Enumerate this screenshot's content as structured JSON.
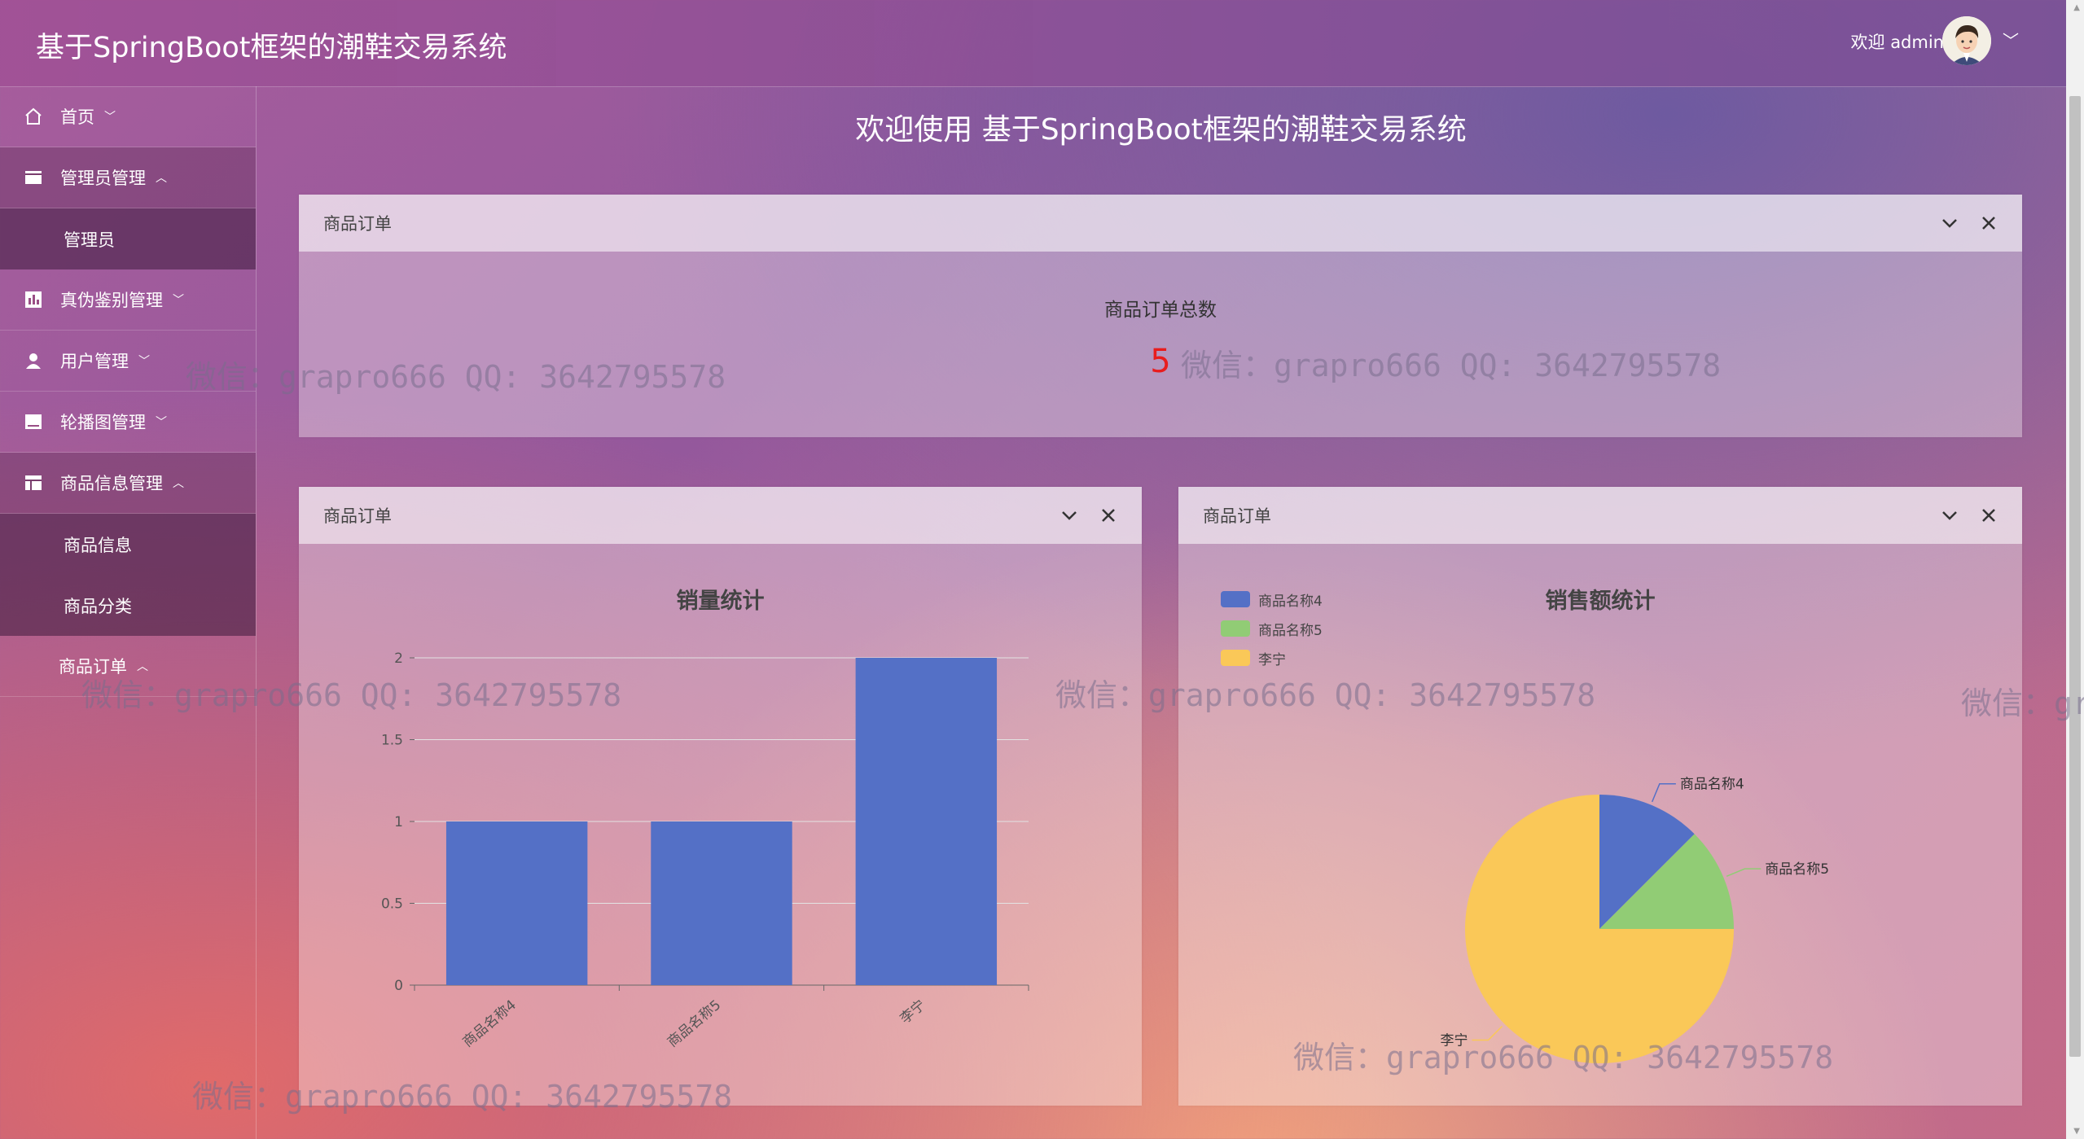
{
  "header": {
    "title": "基于SpringBoot框架的潮鞋交易系统",
    "welcome": "欢迎 admin"
  },
  "sidebar": {
    "items": [
      {
        "label": "首页",
        "icon": "home-icon",
        "chevron": "﹀"
      },
      {
        "label": "管理员管理",
        "icon": "card-icon",
        "chevron": "︿"
      },
      {
        "label": "真伪鉴别管理",
        "icon": "chart-icon",
        "chevron": "﹀"
      },
      {
        "label": "用户管理",
        "icon": "user-icon",
        "chevron": "﹀"
      },
      {
        "label": "轮播图管理",
        "icon": "image-icon",
        "chevron": "﹀"
      },
      {
        "label": "商品信息管理",
        "icon": "table-icon",
        "chevron": "︿"
      },
      {
        "label": "商品订单",
        "icon": "",
        "chevron": "︿"
      }
    ],
    "subitems": {
      "admin": [
        "管理员"
      ],
      "goods": [
        "商品信息",
        "商品分类"
      ]
    }
  },
  "main": {
    "heading": "欢迎使用 基于SpringBoot框架的潮鞋交易系统",
    "panels": [
      {
        "title": "商品订单",
        "stat_label": "商品订单总数",
        "stat_value": "5"
      },
      {
        "title": "商品订单"
      },
      {
        "title": "商品订单"
      }
    ]
  },
  "watermark": "微信：grapro666 QQ: 3642795578",
  "chart_data": [
    {
      "type": "bar",
      "title": "销量统计",
      "categories": [
        "商品名称4",
        "商品名称5",
        "李宁"
      ],
      "values": [
        1,
        1,
        2
      ],
      "ylim": [
        0,
        2
      ],
      "yticks": [
        "0",
        "0.5",
        "1",
        "1.5",
        "2"
      ],
      "color": "#5470c6",
      "grid": true
    },
    {
      "type": "pie",
      "title": "销售额统计",
      "legend_position": "top-left",
      "slices": [
        {
          "name": "商品名称4",
          "value": 1,
          "color": "#5470c6"
        },
        {
          "name": "商品名称5",
          "value": 1,
          "color": "#91cc75"
        },
        {
          "name": "李宁",
          "value": 6,
          "color": "#fac858"
        }
      ]
    }
  ]
}
